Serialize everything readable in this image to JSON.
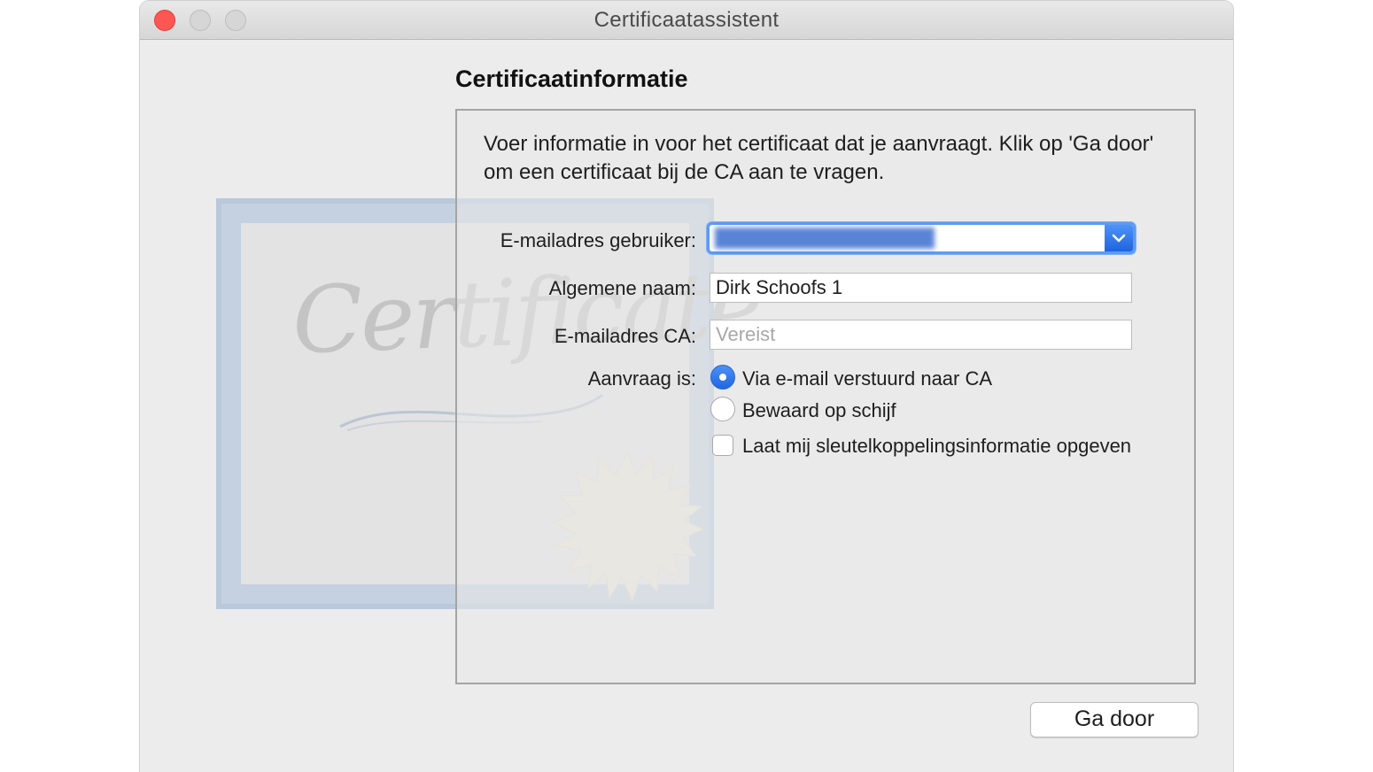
{
  "window": {
    "title": "Certificaatassistent"
  },
  "certificate_art": {
    "script_text": "Certificate"
  },
  "page": {
    "section_title": "Certificaatinformatie",
    "intro": "Voer informatie in voor het certificaat dat je aanvraagt. Klik op 'Ga door' om een certificaat bij de CA aan te vragen."
  },
  "form": {
    "user_email_label": "E-mailadres gebruiker:",
    "common_name_label": "Algemene naam:",
    "common_name_value": "Dirk Schoofs 1",
    "ca_email_label": "E-mailadres CA:",
    "ca_email_placeholder": "Vereist",
    "request_label": "Aanvraag is:",
    "option_email": "Via e-mail verstuurd naar CA",
    "option_disk": "Bewaard op schijf",
    "option_keypair": "Laat mij sleutelkoppelingsinformatie opgeven",
    "selected_option": "option_email",
    "keypair_checked": false
  },
  "buttons": {
    "continue": "Ga door"
  },
  "colors": {
    "accent": "#2a6ee6",
    "close": "#fc5753"
  }
}
